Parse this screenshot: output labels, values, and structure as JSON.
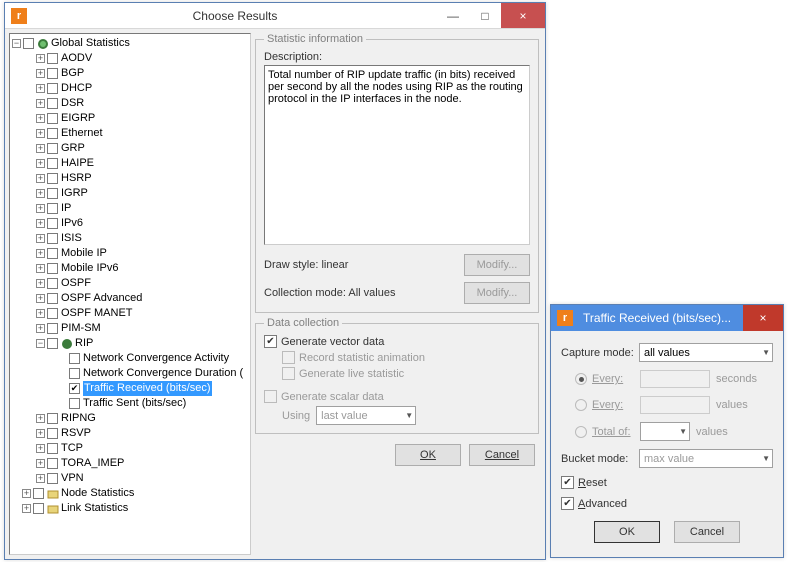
{
  "main_window": {
    "title": "Choose Results",
    "icon_letter": "r",
    "min_label": "—",
    "max_label": "□",
    "close_label": "×"
  },
  "tree": {
    "root": "Global Statistics",
    "items": [
      "AODV",
      "BGP",
      "DHCP",
      "DSR",
      "EIGRP",
      "Ethernet",
      "GRP",
      "HAIPE",
      "HSRP",
      "IGRP",
      "IP",
      "IPv6",
      "ISIS",
      "Mobile IP",
      "Mobile IPv6",
      "OSPF",
      "OSPF Advanced",
      "OSPF MANET",
      "PIM-SM"
    ],
    "rip_label": "RIP",
    "rip_children": [
      "Network Convergence Activity",
      "Network Convergence Duration (",
      "Traffic Received (bits/sec)",
      "Traffic Sent (bits/sec)"
    ],
    "after_rip": [
      "RIPNG",
      "RSVP",
      "TCP",
      "TORA_IMEP",
      "VPN"
    ],
    "siblings": [
      "Node Statistics",
      "Link Statistics"
    ]
  },
  "statinfo": {
    "legend": "Statistic information",
    "desc_label": "Description:",
    "desc_text": "Total number of RIP update traffic (in bits) received per second by all the nodes using RIP as the routing protocol in the IP interfaces in the node.",
    "draw_style_label": "Draw style:",
    "draw_style_value": "linear",
    "modify_label": "Modify...",
    "collection_mode_label": "Collection mode:",
    "collection_mode_value": "All values"
  },
  "datacoll": {
    "legend": "Data collection",
    "gen_vector": "Generate vector data",
    "record_anim": "Record statistic animation",
    "gen_live": "Generate live statistic",
    "gen_scalar": "Generate scalar data",
    "using_label": "Using",
    "using_value": "last value"
  },
  "buttons": {
    "ok": "OK",
    "cancel": "Cancel"
  },
  "dialog2": {
    "title": "Traffic Received (bits/sec)...",
    "close": "×",
    "capture_mode_label": "Capture mode:",
    "capture_mode_value": "all values",
    "every_label": "Every:",
    "seconds": "seconds",
    "values": "values",
    "totalof_label": "Total of:",
    "bucket_mode_label": "Bucket mode:",
    "bucket_mode_value": "max value",
    "reset_label": "Reset",
    "advanced_label": "Advanced",
    "ok": "OK",
    "cancel": "Cancel"
  }
}
